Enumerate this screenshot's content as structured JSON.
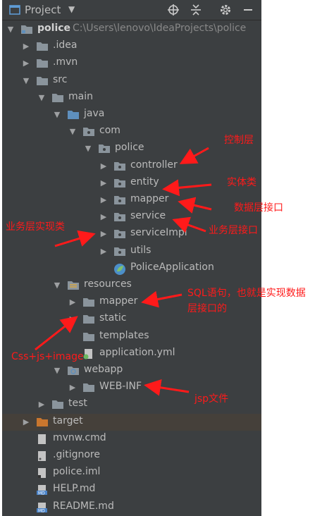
{
  "toolbar": {
    "title": "Project"
  },
  "tree": [
    {
      "id": "police",
      "label": "police",
      "path": "C:\\Users\\lenovo\\IdeaProjects\\police",
      "arrow": "down",
      "icon": "module-folder-icon",
      "level": 0,
      "bold": true
    },
    {
      "id": "idea",
      "label": ".idea",
      "arrow": "right",
      "icon": "folder-icon",
      "level": 1
    },
    {
      "id": "mvn",
      "label": ".mvn",
      "arrow": "right",
      "icon": "folder-icon",
      "level": 1
    },
    {
      "id": "src",
      "label": "src",
      "arrow": "down",
      "icon": "folder-icon",
      "level": 1
    },
    {
      "id": "main",
      "label": "main",
      "arrow": "down",
      "icon": "folder-icon",
      "level": 2
    },
    {
      "id": "java",
      "label": "java",
      "arrow": "down",
      "icon": "source-folder-icon",
      "level": 3
    },
    {
      "id": "com",
      "label": "com",
      "arrow": "down",
      "icon": "package-icon",
      "level": 4
    },
    {
      "id": "pkg-police",
      "label": "police",
      "arrow": "down",
      "icon": "package-icon",
      "level": 5
    },
    {
      "id": "controller",
      "label": "controller",
      "arrow": "right",
      "icon": "package-icon",
      "level": 6
    },
    {
      "id": "entity",
      "label": "entity",
      "arrow": "right",
      "icon": "package-icon",
      "level": 6
    },
    {
      "id": "mapper",
      "label": "mapper",
      "arrow": "right",
      "icon": "package-icon",
      "level": 6
    },
    {
      "id": "service",
      "label": "service",
      "arrow": "right",
      "icon": "package-icon",
      "level": 6
    },
    {
      "id": "serviceimpl",
      "label": "serviceImpl",
      "arrow": "right",
      "icon": "package-icon",
      "level": 6
    },
    {
      "id": "utils",
      "label": "utils",
      "arrow": "right",
      "icon": "package-icon",
      "level": 6
    },
    {
      "id": "policeapplication",
      "label": "PoliceApplication",
      "arrow": "none",
      "icon": "spring-class-icon",
      "level": 6
    },
    {
      "id": "resources",
      "label": "resources",
      "arrow": "down",
      "icon": "resources-folder-icon",
      "level": 3
    },
    {
      "id": "res-mapper",
      "label": "mapper",
      "arrow": "right",
      "icon": "folder-icon",
      "level": 4
    },
    {
      "id": "static",
      "label": "static",
      "arrow": "right",
      "icon": "folder-icon",
      "level": 4
    },
    {
      "id": "templates",
      "label": "templates",
      "arrow": "none",
      "icon": "folder-icon",
      "level": 4
    },
    {
      "id": "application-yml",
      "label": "application.yml",
      "arrow": "none",
      "icon": "yml-file-icon",
      "level": 4
    },
    {
      "id": "webapp",
      "label": "webapp",
      "arrow": "down",
      "icon": "web-folder-icon",
      "level": 3
    },
    {
      "id": "web-inf",
      "label": "WEB-INF",
      "arrow": "right",
      "icon": "folder-icon",
      "level": 4
    },
    {
      "id": "test",
      "label": "test",
      "arrow": "right",
      "icon": "folder-icon",
      "level": 2
    },
    {
      "id": "target",
      "label": "target",
      "arrow": "right",
      "icon": "excluded-folder-icon",
      "level": 1,
      "highlight": true
    },
    {
      "id": "mvnw-cmd",
      "label": "mvnw.cmd",
      "arrow": "none",
      "icon": "file-icon",
      "level": 1
    },
    {
      "id": "gitignore",
      "label": ".gitignore",
      "arrow": "none",
      "icon": "gitignore-file-icon",
      "level": 1
    },
    {
      "id": "police-iml",
      "label": "police.iml",
      "arrow": "none",
      "icon": "iml-file-icon",
      "level": 1
    },
    {
      "id": "help-md",
      "label": "HELP.md",
      "arrow": "none",
      "icon": "md-file-icon",
      "level": 1
    },
    {
      "id": "readme-md",
      "label": "README.md",
      "arrow": "none",
      "icon": "md-file-icon",
      "level": 1
    }
  ],
  "annotations": {
    "controller": "控制层",
    "entity": "实体类",
    "mapper": "数据层接口",
    "service": "业务层接口",
    "serviceimpl": "业务层实现类",
    "sql_line1": "SQL语句，也就是实现数据",
    "sql_line2": "层接口的",
    "static": "Css+js+image",
    "web_inf": "jsp文件"
  },
  "colors": {
    "panel_bg": "#3c3f41",
    "text": "#bbbbbb",
    "folder": "#8a949c",
    "source_folder": "#5e8fbd",
    "excluded_folder": "#c9762e",
    "annotation": "#ff1a1a",
    "highlight_row": "#45403a"
  }
}
